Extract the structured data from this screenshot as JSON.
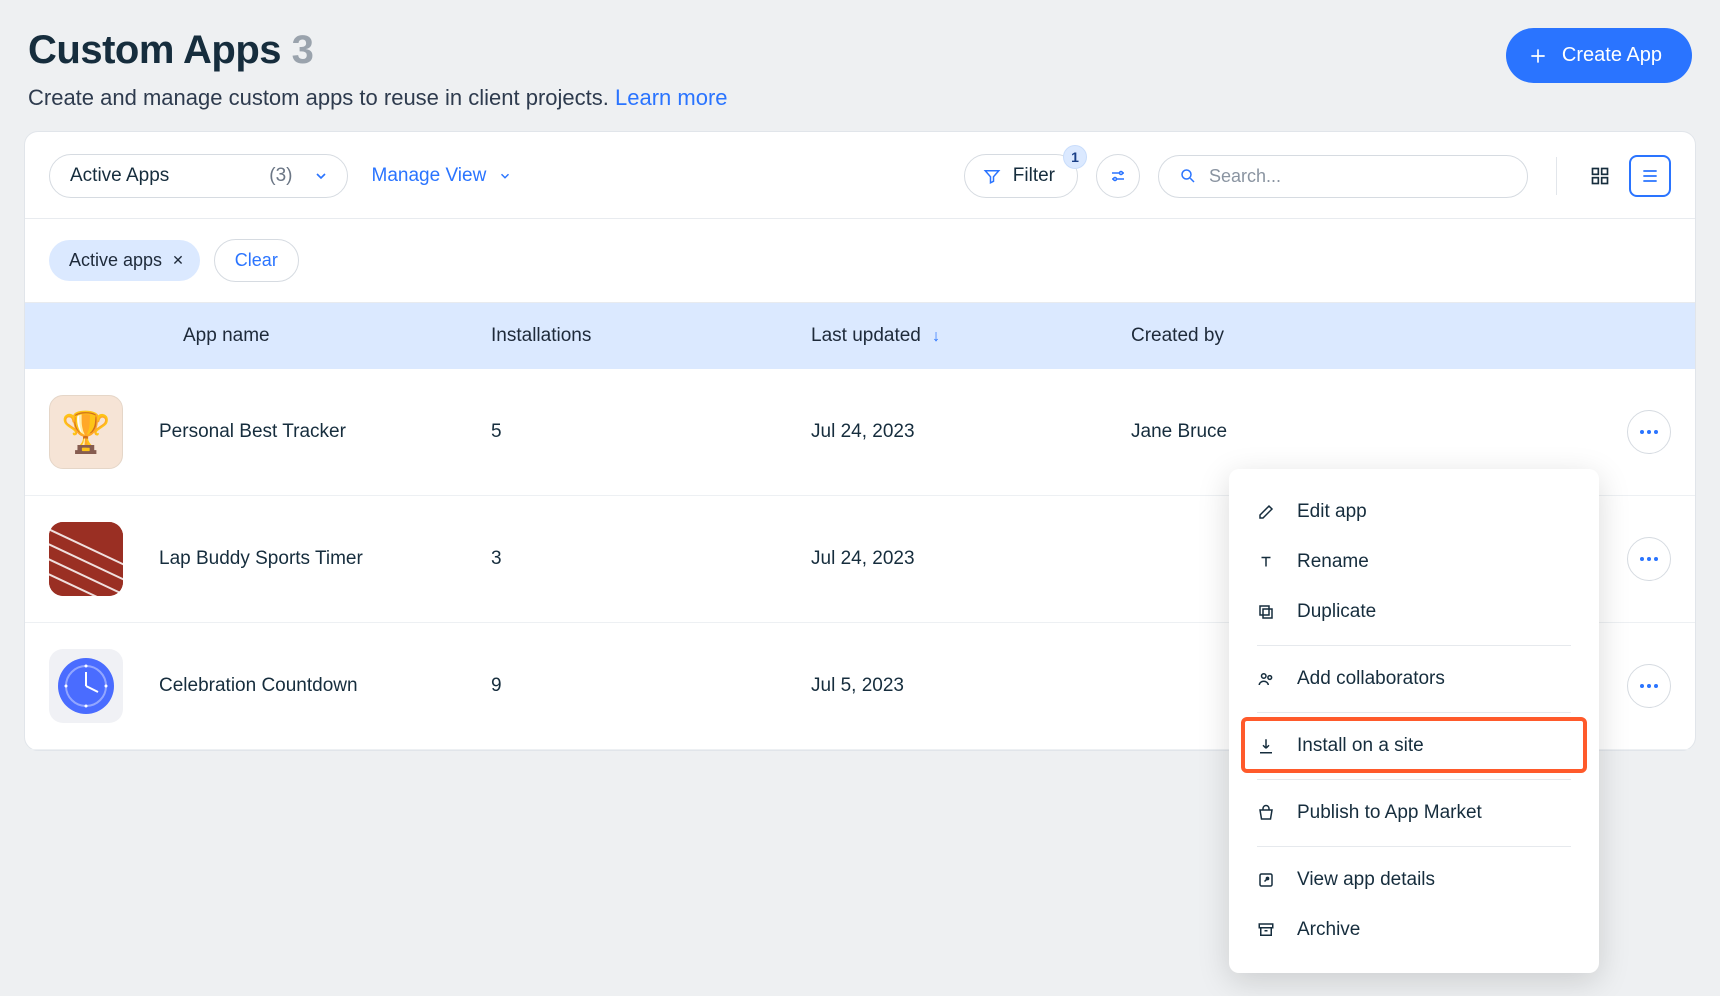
{
  "header": {
    "title": "Custom Apps",
    "count": "3",
    "subtitle": "Create and manage custom apps to reuse in client projects.",
    "learn_more": "Learn more",
    "create_label": "Create App"
  },
  "toolbar": {
    "view_select_label": "Active Apps",
    "view_select_count": "(3)",
    "manage_view_label": "Manage View",
    "filter_label": "Filter",
    "filter_badge": "1",
    "search_placeholder": "Search..."
  },
  "chips": {
    "active_label": "Active apps",
    "clear_label": "Clear"
  },
  "columns": {
    "name": "App name",
    "installations": "Installations",
    "last_updated": "Last updated",
    "created_by": "Created by"
  },
  "rows": [
    {
      "name": "Personal Best Tracker",
      "installations": "5",
      "updated": "Jul 24, 2023",
      "created_by": "Jane Bruce",
      "icon": "trophy"
    },
    {
      "name": "Lap Buddy Sports Timer",
      "installations": "3",
      "updated": "Jul 24, 2023",
      "created_by": "",
      "icon": "track"
    },
    {
      "name": "Celebration Countdown",
      "installations": "9",
      "updated": "Jul 5, 2023",
      "created_by": "",
      "icon": "clock"
    }
  ],
  "context_menu": {
    "edit": "Edit app",
    "rename": "Rename",
    "duplicate": "Duplicate",
    "collab": "Add collaborators",
    "install": "Install on a site",
    "publish": "Publish to App Market",
    "details": "View app details",
    "archive": "Archive"
  }
}
